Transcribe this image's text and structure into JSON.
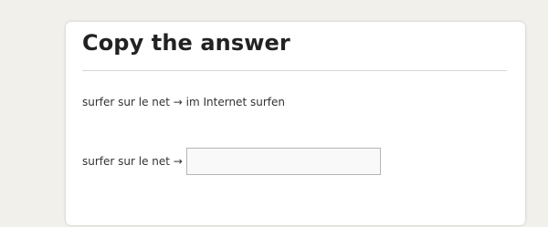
{
  "card": {
    "title": "Copy the answer",
    "example": "surfer sur le net → im Internet surfen",
    "prompt": "surfer sur le net →",
    "answer_value": "",
    "answer_placeholder": ""
  },
  "colors": {
    "page_background": "#f2f0ea",
    "card_background": "#ffffff",
    "divider": "#d6d6d6",
    "input_background": "#f9f9f9"
  }
}
